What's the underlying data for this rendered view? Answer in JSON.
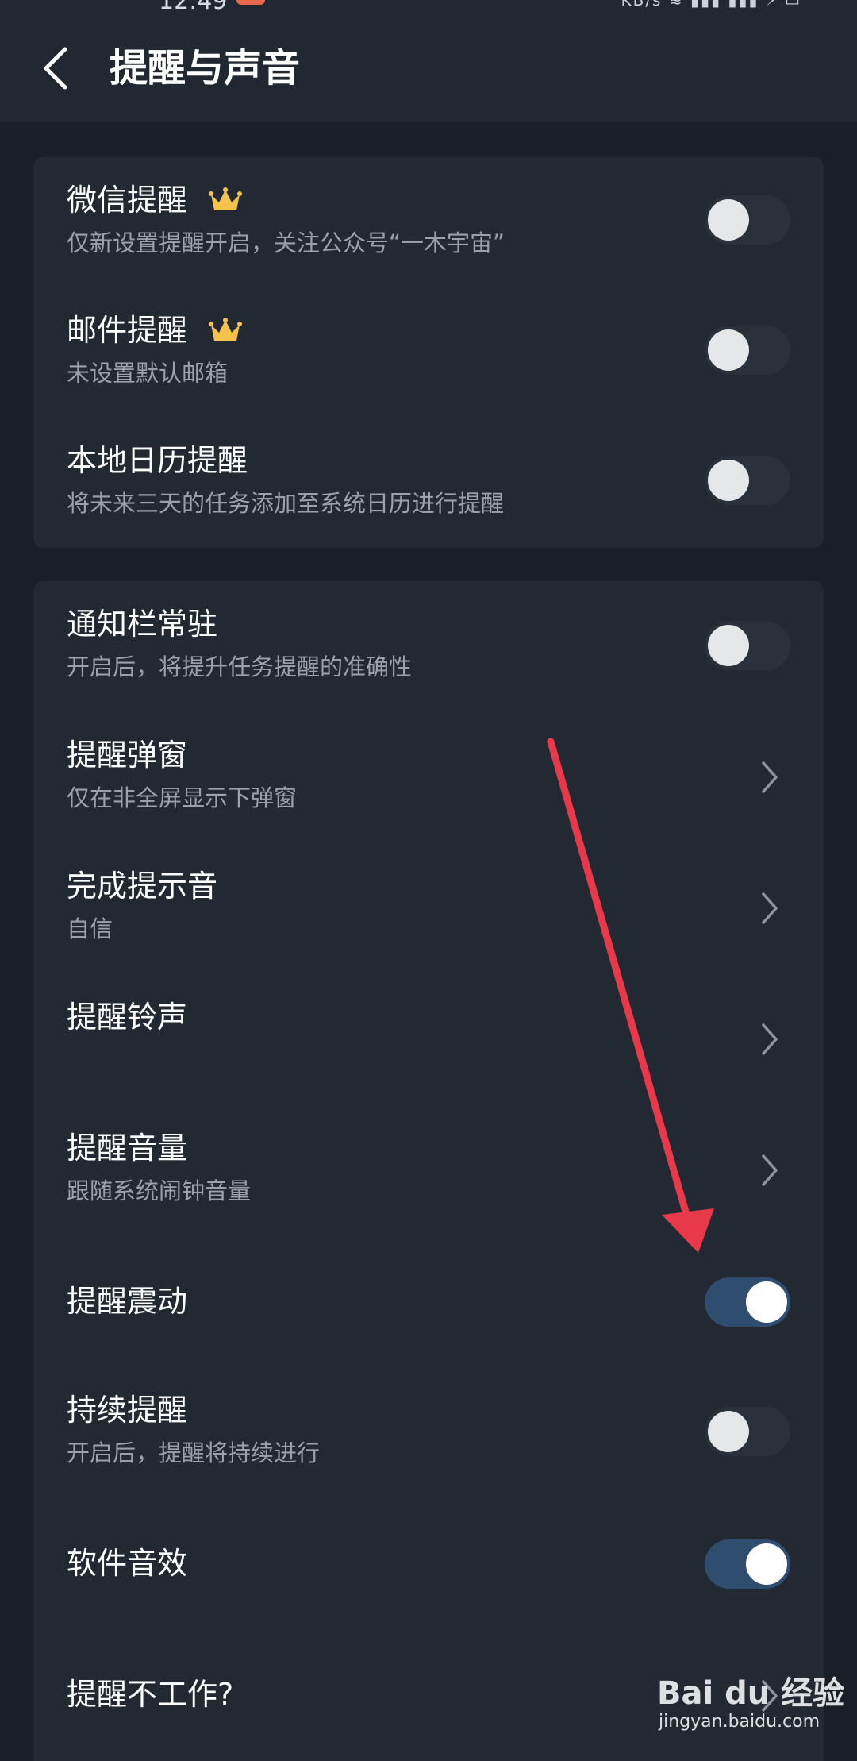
{
  "status_bar": {
    "time": "12:49"
  },
  "header": {
    "title": "提醒与声音"
  },
  "card1": {
    "rows": [
      {
        "title": "微信提醒",
        "subtitle": "仅新设置提醒开启，关注公众号“一木宇宙”",
        "premium": true,
        "toggle": "off"
      },
      {
        "title": "邮件提醒",
        "subtitle": "未设置默认邮箱",
        "premium": true,
        "toggle": "off"
      },
      {
        "title": "本地日历提醒",
        "subtitle": "将未来三天的任务添加至系统日历进行提醒",
        "premium": false,
        "toggle": "off"
      }
    ]
  },
  "card2": {
    "rows": [
      {
        "title": "通知栏常驻",
        "subtitle": "开启后，将提升任务提醒的准确性",
        "control": "toggle",
        "state": "off"
      },
      {
        "title": "提醒弹窗",
        "subtitle": "仅在非全屏显示下弹窗",
        "control": "chevron"
      },
      {
        "title": "完成提示音",
        "subtitle": "自信",
        "control": "chevron"
      },
      {
        "title": "提醒铃声",
        "subtitle": "",
        "control": "chevron"
      },
      {
        "title": "提醒音量",
        "subtitle": "跟随系统闹钟音量",
        "control": "chevron"
      },
      {
        "title": "提醒震动",
        "subtitle": "",
        "control": "toggle",
        "state": "on"
      },
      {
        "title": "持续提醒",
        "subtitle": "开启后，提醒将持续进行",
        "control": "toggle",
        "state": "off"
      },
      {
        "title": "软件音效",
        "subtitle": "",
        "control": "toggle",
        "state": "on"
      },
      {
        "title": "提醒不工作?",
        "subtitle": "",
        "control": "chevron"
      }
    ]
  },
  "colors": {
    "background": "#1a1f27",
    "card": "#232933",
    "toggle_on": "#2f4e6f",
    "annotation_arrow": "#e8394a",
    "crown": "#f5c24c"
  },
  "watermark": {
    "main": "Bai du 经验",
    "sub": "jingyan.baidu.com"
  }
}
